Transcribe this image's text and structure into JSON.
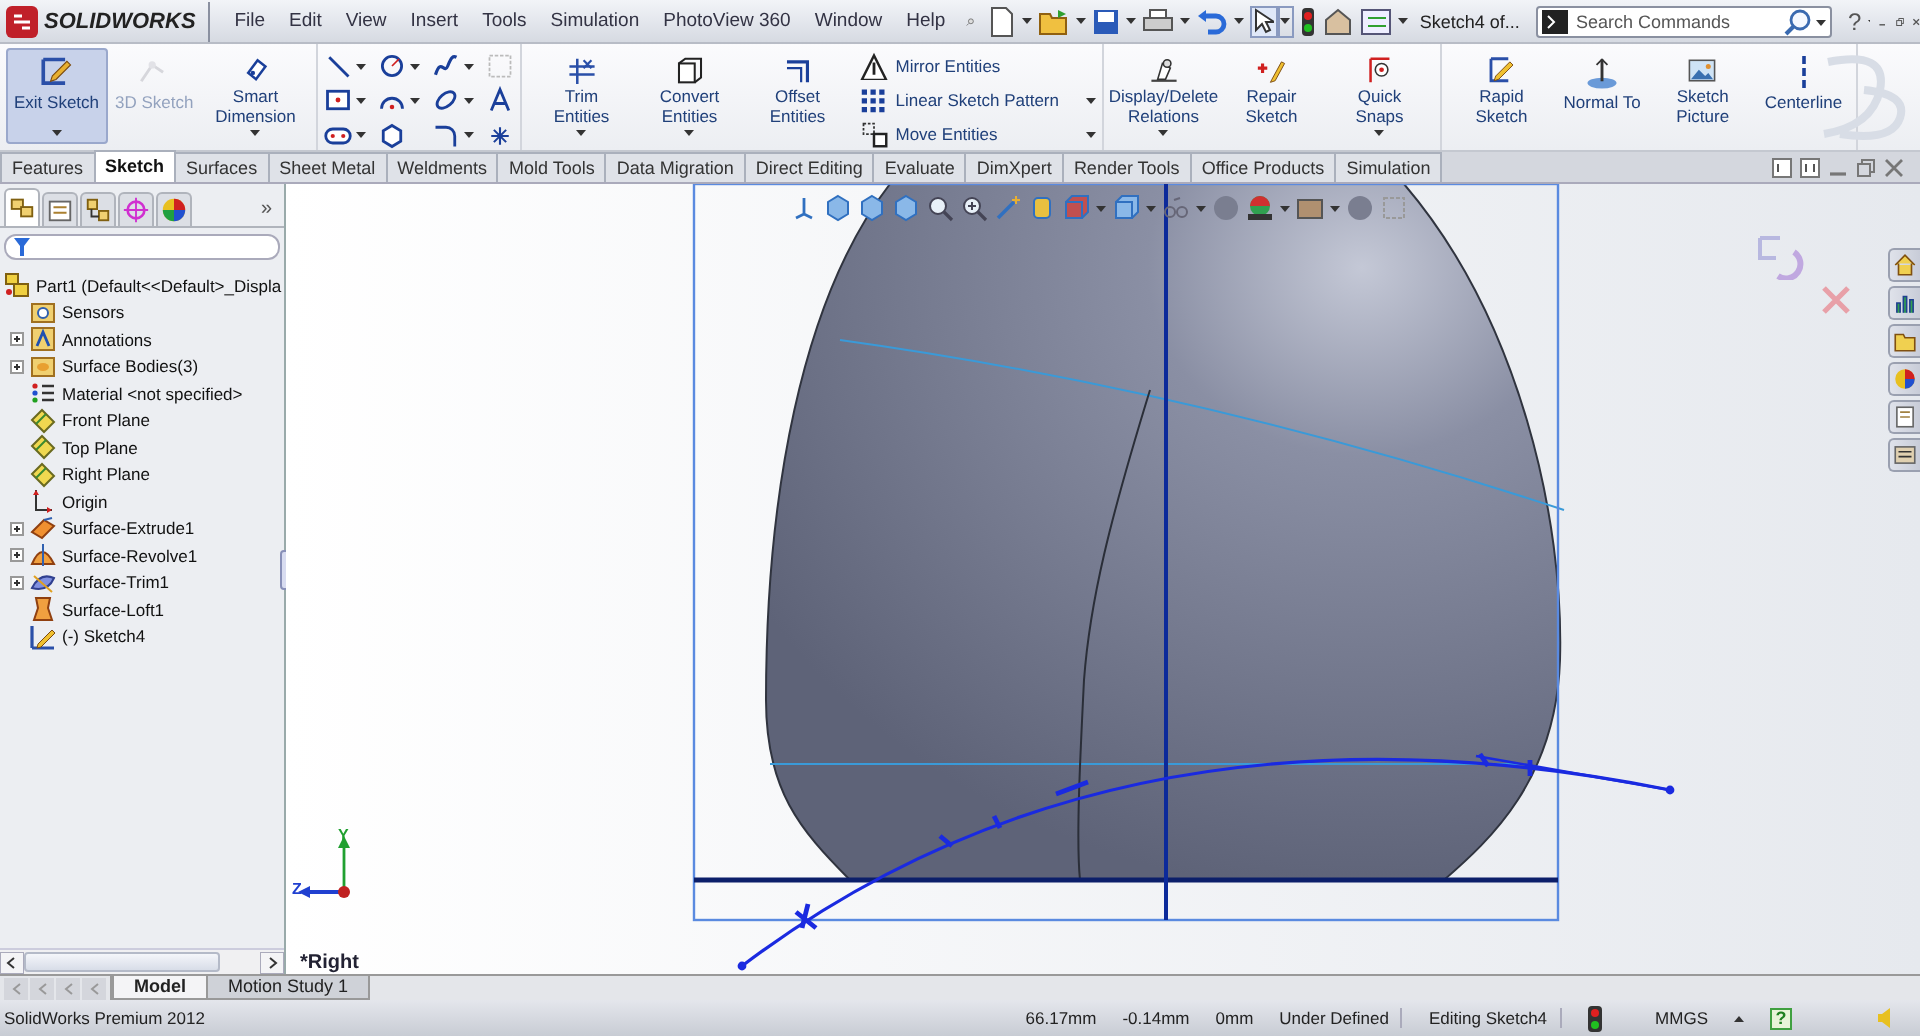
{
  "titlebar": {
    "logo": "SOLIDWORKS",
    "menu": [
      "File",
      "Edit",
      "View",
      "Insert",
      "Tools",
      "Simulation",
      "PhotoView 360",
      "Window",
      "Help"
    ],
    "document": "Sketch4 of...",
    "search": {
      "placeholder": "Search Commands"
    },
    "help": "?"
  },
  "ribbon": [
    {
      "kind": "buttons",
      "items": [
        {
          "label": "Exit Sketch",
          "selected": true,
          "disabled": false,
          "dropdown": true
        },
        {
          "label": "3D Sketch",
          "selected": false,
          "disabled": true,
          "dropdown": false
        },
        {
          "label": "Smart Dimension",
          "selected": false,
          "disabled": false,
          "dropdown": true
        }
      ]
    },
    {
      "kind": "tools"
    },
    {
      "kind": "buttons",
      "items": [
        {
          "label": "Trim Entities",
          "selected": false,
          "disabled": false,
          "dropdown": true
        },
        {
          "label": "Convert Entities",
          "selected": false,
          "disabled": false,
          "dropdown": true
        },
        {
          "label": "Offset Entities",
          "selected": false,
          "disabled": false,
          "dropdown": false
        }
      ],
      "list": [
        {
          "label": "Mirror Entities",
          "dropdown": false
        },
        {
          "label": "Linear Sketch Pattern",
          "dropdown": true
        },
        {
          "label": "Move Entities",
          "dropdown": true
        }
      ]
    },
    {
      "kind": "buttons",
      "items": [
        {
          "label": "Display/Delete Relations",
          "selected": false,
          "disabled": false,
          "dropdown": true
        },
        {
          "label": "Repair Sketch",
          "selected": false,
          "disabled": false,
          "dropdown": false
        },
        {
          "label": "Quick Snaps",
          "selected": false,
          "disabled": false,
          "dropdown": true
        }
      ]
    },
    {
      "kind": "buttons",
      "items": [
        {
          "label": "Rapid Sketch",
          "selected": false,
          "disabled": false,
          "dropdown": false
        },
        {
          "label": "Normal To",
          "selected": false,
          "disabled": false,
          "dropdown": false
        },
        {
          "label": "Sketch Picture",
          "selected": false,
          "disabled": false,
          "dropdown": false
        },
        {
          "label": "Centerline",
          "selected": false,
          "disabled": false,
          "dropdown": false
        }
      ]
    }
  ],
  "command_tabs": [
    {
      "label": "Features",
      "selected": false
    },
    {
      "label": "Sketch",
      "selected": true
    },
    {
      "label": "Surfaces",
      "selected": false
    },
    {
      "label": "Sheet Metal",
      "selected": false
    },
    {
      "label": "Weldments",
      "selected": false
    },
    {
      "label": "Mold Tools",
      "selected": false
    },
    {
      "label": "Data Migration",
      "selected": false
    },
    {
      "label": "Direct Editing",
      "selected": false
    },
    {
      "label": "Evaluate",
      "selected": false
    },
    {
      "label": "DimXpert",
      "selected": false
    },
    {
      "label": "Render Tools",
      "selected": false
    },
    {
      "label": "Office Products",
      "selected": false
    },
    {
      "label": "Simulation",
      "selected": false
    }
  ],
  "panel": {
    "tabs": [
      {
        "selected": true
      },
      {
        "selected": false
      },
      {
        "selected": false
      },
      {
        "selected": false
      },
      {
        "selected": false
      }
    ],
    "overflow": "»",
    "tree": {
      "label": "Part1  (Default<<Default>_Displa",
      "children": [
        {
          "label": "Sensors",
          "expander": false
        },
        {
          "label": "Annotations",
          "expander": true
        },
        {
          "label": "Surface Bodies(3)",
          "expander": true
        },
        {
          "label": "Material <not specified>",
          "expander": false
        },
        {
          "label": "Front Plane",
          "expander": false
        },
        {
          "label": "Top Plane",
          "expander": false
        },
        {
          "label": "Right Plane",
          "expander": false
        },
        {
          "label": "Origin",
          "expander": false
        },
        {
          "label": "Surface-Extrude1",
          "expander": true
        },
        {
          "label": "Surface-Revolve1",
          "expander": true
        },
        {
          "label": "Surface-Trim1",
          "expander": true
        },
        {
          "label": "Surface-Loft1",
          "expander": false
        },
        {
          "label": "(-) Sketch4",
          "expander": false
        }
      ]
    }
  },
  "viewport": {
    "view_name": "*Right",
    "axis_y": "Y",
    "axis_z": "Z"
  },
  "bottom_tabs": [
    {
      "label": "Model",
      "selected": true
    },
    {
      "label": "Motion Study 1",
      "selected": false
    }
  ],
  "status_bar": {
    "product": "SolidWorks Premium 2012",
    "fields": [
      "66.17mm",
      "-0.14mm",
      "0mm",
      "Under Defined",
      "Editing Sketch4"
    ],
    "units": "MMGS",
    "help": "?"
  }
}
